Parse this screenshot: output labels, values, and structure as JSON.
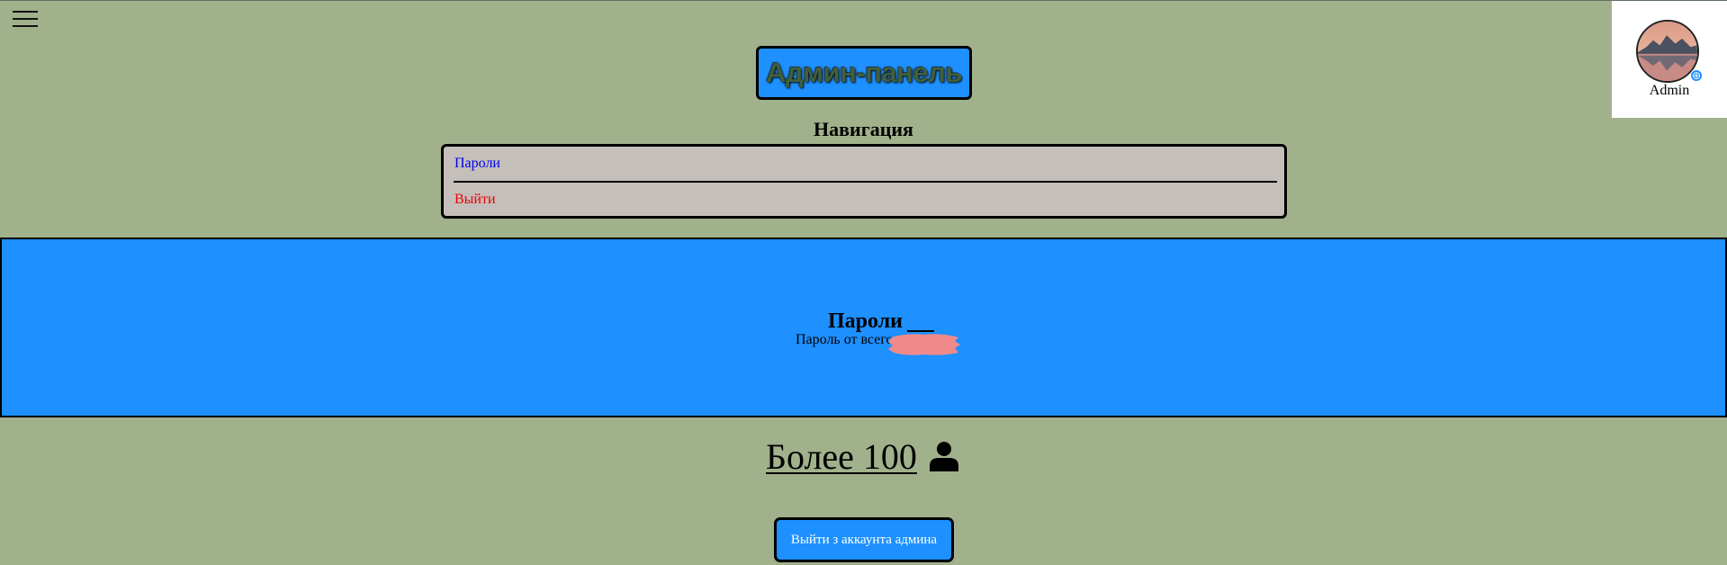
{
  "header": {
    "title": "Админ-панель",
    "menu_icon": "hamburger-menu-icon"
  },
  "profile": {
    "name": "Admin",
    "add_icon": "⊕"
  },
  "navigation": {
    "heading": "Навигация",
    "items": [
      {
        "label": "Пароли",
        "color": "#0000ee"
      },
      {
        "label": "Выйти",
        "color": "#ee0000"
      }
    ]
  },
  "passwords": {
    "heading": "Пароли",
    "text": "Пароль от всего",
    "redaction_color": "#f08a8a"
  },
  "stats": {
    "count_text": "Более 100",
    "icon": "user-icon"
  },
  "actions": {
    "logout_label": "Выйти з аккаунта админа"
  },
  "colors": {
    "page_background": "#a1b18b",
    "accent": "#1e90ff",
    "nav_background": "#c4bfbb"
  }
}
